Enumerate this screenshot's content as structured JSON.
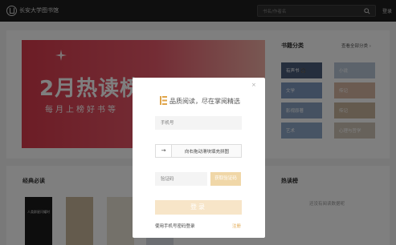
{
  "header": {
    "site_name": "长安大学图书馆",
    "search_placeholder": "书名/作者名",
    "login": "登录"
  },
  "banner": {
    "title": "2月热读榜",
    "subtitle": "每月上榜好书等"
  },
  "categories": {
    "title": "书籍分类",
    "see_all": "查看全部分类 ›",
    "items": [
      {
        "label": "有声书 🎧",
        "color": "#4a5c7a"
      },
      {
        "label": "小说",
        "color": "#b9c6d6"
      },
      {
        "label": "文学",
        "color": "#7e98bf"
      },
      {
        "label": "传记",
        "color": "#d7b7a3"
      },
      {
        "label": "影视原著",
        "color": "#8aa3c2"
      },
      {
        "label": "传记",
        "color": "#c8b59c"
      },
      {
        "label": "艺术",
        "color": "#8fa8c8"
      },
      {
        "label": "心理与哲学",
        "color": "#cfc4b7"
      }
    ]
  },
  "classic": {
    "title": "经典必读",
    "books": [
      {
        "title": "人类群星闪耀时",
        "color": "#1a1a1a"
      },
      {
        "title": "",
        "color": "#c9b79a"
      },
      {
        "title": "",
        "color": "#e8e2d5"
      },
      {
        "title": "",
        "color": "#d8dde4"
      }
    ]
  },
  "hot": {
    "title": "热读榜",
    "empty": "还没有阅读数据呢"
  },
  "modal": {
    "slogan": "品质阅读，尽在掌阅精选",
    "phone_placeholder": "手机号",
    "slider_text": "向右拖动滑块填充拼图",
    "code_placeholder": "验证码",
    "code_button": "获取验证码",
    "login_button": "登录",
    "password_login": "使用手机号密码登录",
    "register": "注册",
    "accent": "#e0a54a"
  }
}
